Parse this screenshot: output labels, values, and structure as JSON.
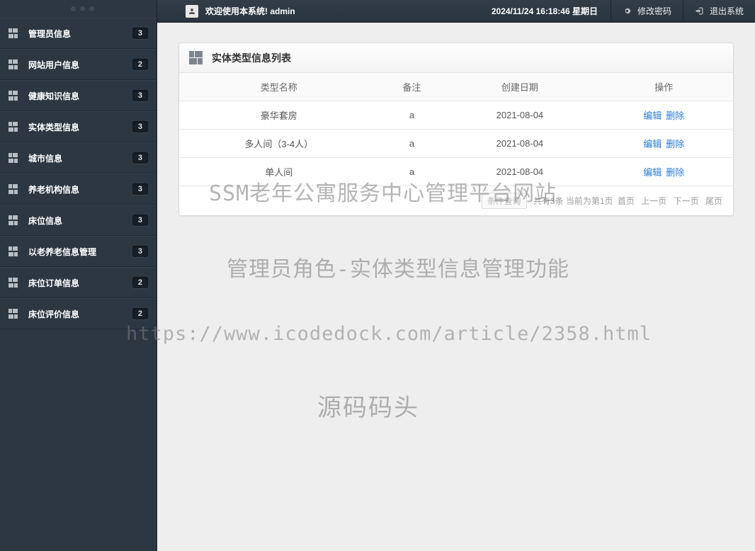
{
  "sidebar": {
    "items": [
      {
        "label": "管理员信息",
        "badge": "3"
      },
      {
        "label": "网站用户信息",
        "badge": "2"
      },
      {
        "label": "健康知识信息",
        "badge": "3"
      },
      {
        "label": "实体类型信息",
        "badge": "3"
      },
      {
        "label": "城市信息",
        "badge": "3"
      },
      {
        "label": "养老机构信息",
        "badge": "3"
      },
      {
        "label": "床位信息",
        "badge": "3"
      },
      {
        "label": "以老养老信息管理",
        "badge": "3"
      },
      {
        "label": "床位订单信息",
        "badge": "2"
      },
      {
        "label": "床位评价信息",
        "badge": "2"
      }
    ]
  },
  "topbar": {
    "welcome": "欢迎使用本系统! admin",
    "datetime": "2024/11/24 16:18:46 星期日",
    "change_pwd": "修改密码",
    "logout": "退出系统"
  },
  "panel": {
    "title": "实体类型信息列表"
  },
  "table": {
    "headers": [
      "类型名称",
      "备注",
      "创建日期",
      "操作"
    ],
    "rows": [
      {
        "name": "豪华套房",
        "remark": "a",
        "date": "2021-08-04"
      },
      {
        "name": "多人间（3-4人）",
        "remark": "a",
        "date": "2021-08-04"
      },
      {
        "name": "单人间",
        "remark": "a",
        "date": "2021-08-04"
      }
    ],
    "edit": "编辑",
    "delete": "删除"
  },
  "pager": {
    "search_btn": "条件查询",
    "info": "共有3条  当前为第1页",
    "first": "首页",
    "prev": "上一页",
    "next": "下一页",
    "last": "尾页"
  },
  "watermark": {
    "line1": "SSM老年公寓服务中心管理平台网站",
    "line2": "管理员角色-实体类型信息管理功能",
    "url": "https://www.icodedock.com/article/2358.html",
    "brand": "源码码头"
  }
}
